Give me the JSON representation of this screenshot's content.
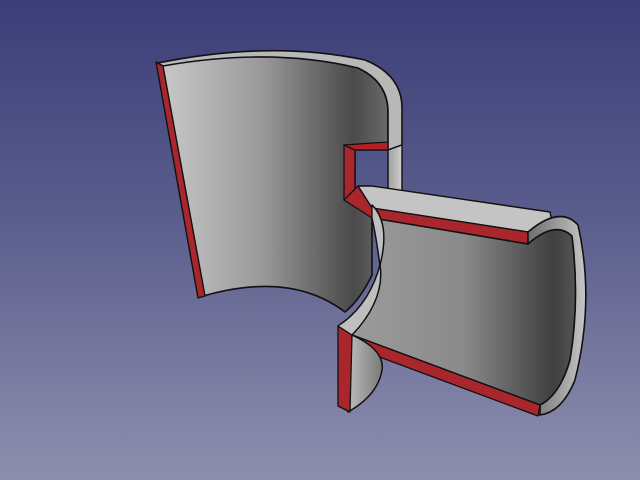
{
  "viewport": {
    "background_top": "#3b3e78",
    "background_bottom": "#8e8fae"
  },
  "model": {
    "shape_type": "sectioned pipe tee",
    "surface_color": "#a9a9a9",
    "cut_face_color": "#a8262c",
    "edge_color": "#111111"
  }
}
